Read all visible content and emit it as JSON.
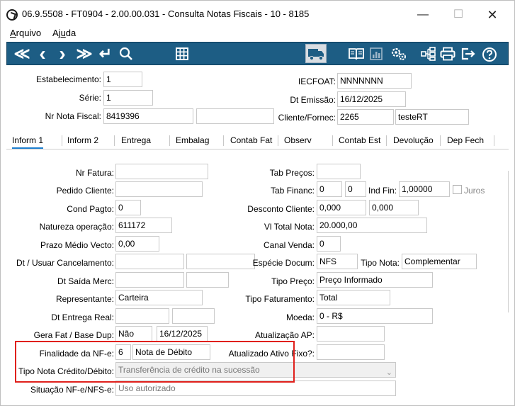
{
  "window": {
    "title": "06.9.5508 - FT0904 - 2.00.00.031 - Consulta Notas Fiscais - 10 - 8185",
    "minimize": "—",
    "maximize": "☐",
    "close": "✕"
  },
  "menu": {
    "items": [
      {
        "first": "A",
        "rest": "rquivo"
      },
      {
        "first": "Aj",
        "rest": "u",
        "tail": "da"
      }
    ]
  },
  "toolbar": {
    "first": "≪",
    "prev": "‹",
    "next": "›",
    "last": "≫",
    "back": "↵",
    "search_icon": "search-icon",
    "grid_icon": "grid-icon",
    "truck_icon": "truck-icon",
    "book_icon": "book-icon",
    "chart_icon": "chart-icon",
    "gears_icon": "gears-icon",
    "network_icon": "network-icon",
    "print_icon": "print-icon",
    "exit_icon": "exit-icon",
    "help_icon": "help-icon"
  },
  "header": {
    "estabelecimento_label": "Estabelecimento:",
    "estabelecimento_value": "1",
    "serie_label": "Série:",
    "serie_value": "1",
    "nr_nota_label": "Nr Nota Fiscal:",
    "nr_nota_value": "8419396",
    "nr_nota_extra": "",
    "iecfoat_label": "IECFOAT:",
    "iecfoat_value": "NNNNNNN",
    "dt_emissao_label": "Dt Emissão:",
    "dt_emissao_value": "16/12/2025",
    "cliente_label": "Cliente/Fornec:",
    "cliente_code": "2265",
    "cliente_name": "testeRT"
  },
  "tabs": [
    {
      "label": "Inform 1"
    },
    {
      "label": "Inform 2"
    },
    {
      "label": "Entrega"
    },
    {
      "label": "Embalag"
    },
    {
      "label": "Contab Fat"
    },
    {
      "label": "Observ"
    },
    {
      "label": "Contab Est"
    },
    {
      "label": "Devolução"
    },
    {
      "label": "Dep Fech"
    }
  ],
  "form": {
    "nr_fatura_label": "Nr Fatura:",
    "nr_fatura_value": "",
    "pedido_cliente_label": "Pedido Cliente:",
    "pedido_cliente_value": "",
    "cond_pagto_label": "Cond Pagto:",
    "cond_pagto_value": "0",
    "natureza_label": "Natureza operação:",
    "natureza_value": "611172",
    "prazo_label": "Prazo Médio Vecto:",
    "prazo_value": "0,00",
    "dt_usuar_label": "Dt / Usuar Cancelamento:",
    "dt_usuar_value1": "",
    "dt_usuar_value2": "",
    "dt_saida_label": "Dt Saída Merc:",
    "dt_saida_value1": "",
    "dt_saida_value2": "",
    "representante_label": "Representante:",
    "representante_value": "Carteira",
    "dt_entrega_label": "Dt Entrega Real:",
    "dt_entrega_value1": "",
    "dt_entrega_value2": "",
    "gera_fat_label": "Gera Fat / Base Dup:",
    "gera_fat_value": "Não",
    "base_dup_value": "16/12/2025",
    "finalidade_label": "Finalidade da NF-e:",
    "finalidade_code": "6",
    "finalidade_desc": "Nota de Débito",
    "tipo_nota_cred_label": "Tipo Nota Crédito/Débito:",
    "tipo_nota_cred_value": "Transferência de crédito na sucessão",
    "situacao_label": "Situação NF-e/NFS-e:",
    "situacao_value": "Uso autorizado",
    "tab_precos_label": "Tab Preços:",
    "tab_precos_value": "",
    "tab_financ_label": "Tab Financ:",
    "tab_financ_value1": "0",
    "tab_financ_value2": "0",
    "ind_fin_label": "Ind Fin:",
    "ind_fin_value": "1,00000",
    "juros_label": "Juros",
    "desconto_label": "Desconto Cliente:",
    "desconto_value1": "0,000",
    "desconto_value2": "0,000",
    "vl_total_label": "Vl Total Nota:",
    "vl_total_value": "20.000,00",
    "canal_venda_label": "Canal Venda:",
    "canal_venda_value": "0",
    "especie_label": "Espécie Docum:",
    "especie_value": "NFS",
    "tipo_nota_label": "Tipo Nota:",
    "tipo_nota_value": "Complementar",
    "tipo_preco_label": "Tipo Preço:",
    "tipo_preco_value": "Preço Informado",
    "tipo_fat_label": "Tipo Faturamento:",
    "tipo_fat_value": "Total",
    "moeda_label": "Moeda:",
    "moeda_value": "0 - R$",
    "atualizacao_ap_label": "Atualização AP:",
    "atualizacao_ap_value": "",
    "atualizado_label": "Atualizado Ativo Fixo?:",
    "atualizado_value": ""
  },
  "colors": {
    "toolbar_bg": "#1d5d84",
    "highlight": "#e0201c",
    "active_tab": "#1d7fcf"
  }
}
